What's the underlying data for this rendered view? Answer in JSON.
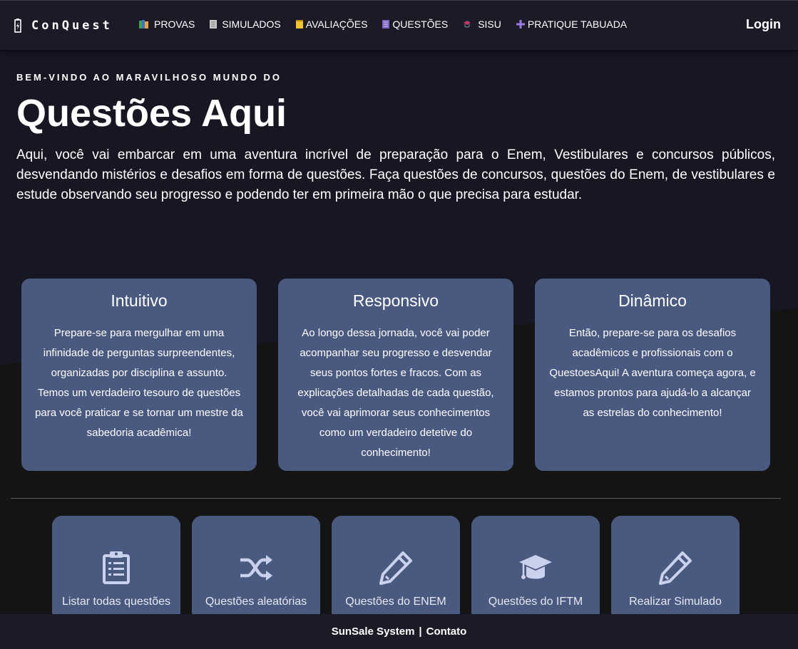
{
  "navbar": {
    "brand": "ConQuest",
    "links": [
      {
        "label": "PROVAS",
        "icon": "books-icon"
      },
      {
        "label": "SIMULADOS",
        "icon": "notebook-icon"
      },
      {
        "label": "AVALIAÇÕES",
        "icon": "notepad-icon"
      },
      {
        "label": "QUESTÕES",
        "icon": "document-icon"
      },
      {
        "label": "SISU",
        "icon": "graduation-icon"
      },
      {
        "label": "PRATIQUE TABUADA",
        "icon": "plus-icon"
      }
    ],
    "login": "Login"
  },
  "hero": {
    "eyebrow": "BEM-VINDO AO MARAVILHOSO MUNDO DO",
    "title": "Questões Aqui",
    "text": "Aqui, você vai embarcar em uma aventura incrível de preparação para o Enem, Vestibulares e concursos públicos, desvendando mistérios e desafios em forma de questões. Faça questões de concursos, questões do Enem, de vestibulares e estude observando seu progresso e podendo ter em primeira mão o que precisa para estudar."
  },
  "features": [
    {
      "title": "Intuitivo",
      "text": "Prepare-se para mergulhar em uma infinidade de perguntas surpreendentes, organizadas por disciplina e assunto. Temos um verdadeiro tesouro de questões para você praticar e se tornar um mestre da sabedoria acadêmica!"
    },
    {
      "title": "Responsivo",
      "text": "Ao longo dessa jornada, você vai poder acompanhar seu progresso e desvendar seus pontos fortes e fracos. Com as explicações detalhadas de cada questão, você vai aprimorar seus conhecimentos como um verdadeiro detetive do conhecimento!"
    },
    {
      "title": "Dinâmico",
      "text": "Então, prepare-se para os desafios acadêmicos e profissionais com o QuestoesAqui! A aventura começa agora, e estamos prontos para ajudá-lo a alcançar as estrelas do conhecimento!"
    }
  ],
  "tiles": [
    {
      "label": "Listar todas questões",
      "icon": "clipboard-icon"
    },
    {
      "label": "Questões aleatórias",
      "icon": "shuffle-icon"
    },
    {
      "label": "Questões do ENEM",
      "icon": "pencil-icon"
    },
    {
      "label": "Questões do IFTM",
      "icon": "graduation-cap-icon"
    },
    {
      "label": "Realizar Simulado",
      "icon": "pencil-icon"
    }
  ],
  "footer": {
    "company": "SunSale System",
    "separator": "|",
    "contact": "Contato"
  },
  "colors": {
    "background": "#141414",
    "hero_background": "#171724",
    "navbar": "#1b1b27",
    "card": "#4a5980",
    "icon": "#c9d1ec"
  }
}
